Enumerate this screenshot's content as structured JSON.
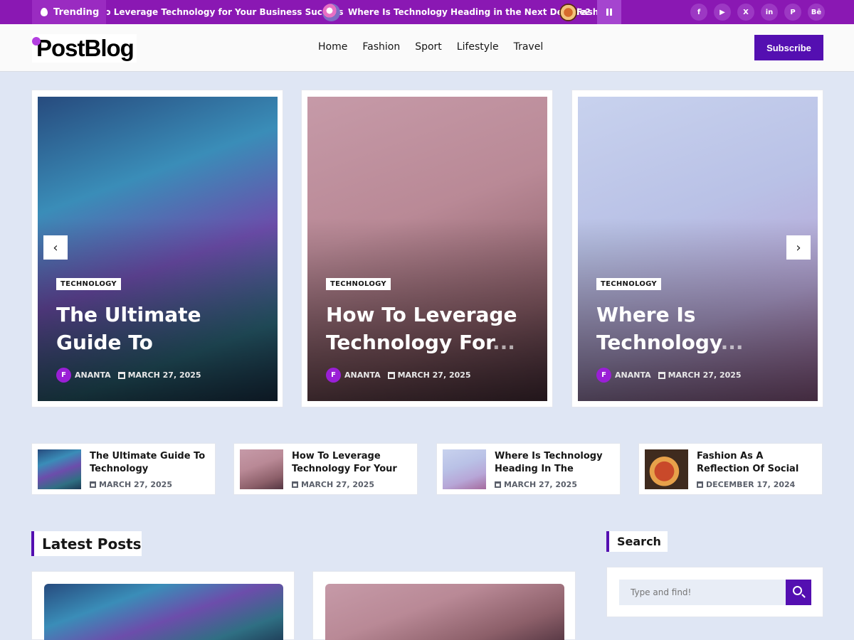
{
  "topbar": {
    "trending_label": "Trending",
    "ticker": [
      "How to Leverage Technology for Your Business Success",
      "Where Is Technology Heading in the Next Decade?",
      "Fashion As A Reflection"
    ],
    "social_icons": [
      "facebook-icon",
      "youtube-icon",
      "x-icon",
      "linkedin-icon",
      "pinterest-icon",
      "behance-icon"
    ],
    "social_glyphs": [
      "f",
      "▶",
      "X",
      "in",
      "P",
      "Bē"
    ]
  },
  "header": {
    "logo": "PostBlog",
    "nav": [
      "Home",
      "Fashion",
      "Sport",
      "Lifestyle",
      "Travel"
    ],
    "subscribe": "Subscribe"
  },
  "slider": [
    {
      "category": "TECHNOLOGY",
      "title": "The Ultimate Guide To Technology",
      "author": "ANANTA",
      "date": "MARCH 27, 2025"
    },
    {
      "category": "TECHNOLOGY",
      "title": "How To Leverage Technology For",
      "author": "ANANTA",
      "date": "MARCH 27, 2025"
    },
    {
      "category": "TECHNOLOGY",
      "title": "Where Is Technology",
      "author": "ANANTA",
      "date": "MARCH 27, 2025"
    }
  ],
  "small_posts": [
    {
      "title": "The Ultimate Guide To Technology Innovations",
      "date": "MARCH 27, 2025"
    },
    {
      "title": "How To Leverage Technology For Your",
      "date": "MARCH 27, 2025"
    },
    {
      "title": "Where Is Technology Heading In The",
      "date": "MARCH 27, 2025"
    },
    {
      "title": "Fashion As A Reflection Of Social",
      "date": "DECEMBER 17, 2024"
    }
  ],
  "latest_posts": {
    "heading": "Latest Posts"
  },
  "search": {
    "heading": "Search",
    "placeholder": "Type and find!"
  },
  "colors": {
    "brand": "#540fb1",
    "topbar": "#8a18b3",
    "background": "#dfe6f4"
  }
}
